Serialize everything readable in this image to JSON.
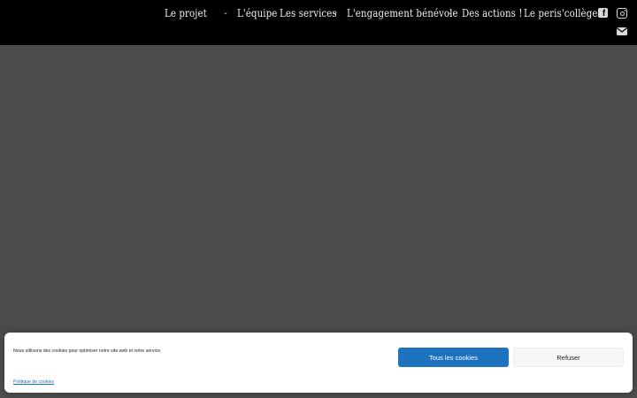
{
  "nav": {
    "items": [
      {
        "label": "Le projet",
        "has_dropdown": true
      },
      {
        "label": "L'équipe",
        "has_dropdown": false
      },
      {
        "label": "Les services",
        "has_dropdown": true
      },
      {
        "label": "L'engagement bénévole",
        "has_dropdown": true
      },
      {
        "label": "Des actions !",
        "has_dropdown": false
      },
      {
        "label": "Le peris'collège",
        "has_dropdown": false
      }
    ],
    "dropdown_glyph": "⌄"
  },
  "social": {
    "icons": [
      "facebook-icon",
      "instagram-icon",
      "envelope-icon"
    ],
    "facebook_glyph": "f"
  },
  "cookie_banner": {
    "message": "Nous utilisons des cookies pour optimiser notre site web et notre service.",
    "accept_label": "Tous les cookies",
    "deny_label": "Refuser",
    "policy_link": "Politique de cookies",
    "accent_color": "#1e73be"
  },
  "colors": {
    "header_bg": "#000000",
    "page_bg": "#4b4b4b"
  }
}
